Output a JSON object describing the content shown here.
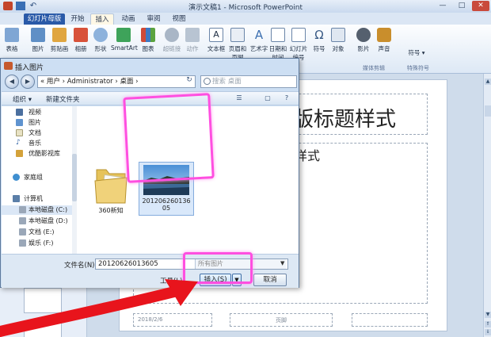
{
  "app": {
    "title": "演示文稿1 - Microsoft PowerPoint",
    "file_tab": "幻灯片母版",
    "tabs": [
      "开始",
      "插入",
      "动画",
      "审阅",
      "视图"
    ]
  },
  "ribbon": {
    "buttons": [
      "表格",
      "图片",
      "剪贴画",
      "相册",
      "形状",
      "SmartArt",
      "图表",
      "超链接",
      "动作",
      "文本框",
      "页眉和页脚",
      "艺术字",
      "日期和时间",
      "幻灯片编号",
      "符号",
      "对象",
      "影片",
      "声音"
    ],
    "groups": [
      "媒体剪辑",
      "特殊符号"
    ],
    "symbol_label": "符号"
  },
  "slide": {
    "title": "版标题样式",
    "subtitle": "样式",
    "footer_date": "2018/2/6",
    "footer_text": "页脚"
  },
  "dialog": {
    "title": "插入图片",
    "address": "« 用户 › Administrator › 桌面 ›",
    "search_placeholder": "搜索 桌面",
    "toolbar": {
      "organize": "组织 ▾",
      "new_folder": "新建文件夹"
    },
    "nav_items": [
      "视频",
      "图片",
      "文档",
      "音乐",
      "优酷影视库",
      "家庭组",
      "计算机",
      "本地磁盘 (C:)",
      "本地磁盘 (D:)",
      "文档 (E:)",
      "娱乐 (F:)"
    ],
    "files": [
      {
        "name": "360新知",
        "type": "folder"
      },
      {
        "name": "20120626013605",
        "type": "image"
      }
    ],
    "filename_label": "文件名(N):",
    "filename_value": "20120626013605",
    "filter_value": "所有图片",
    "tools_label": "工具(L)",
    "insert_label": "插入(S)",
    "cancel_label": "取消"
  },
  "colors": {
    "highlight": "#ff4fe0",
    "arrow": "#e8141c",
    "accent": "#2a5aa8"
  }
}
